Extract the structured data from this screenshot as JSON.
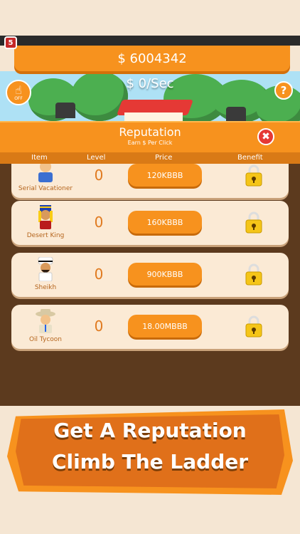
{
  "hud": {
    "level_badge": "5",
    "money": "$ 6004342",
    "per_sec": "$ 0/Sec",
    "auto_click_off": "OFF",
    "help": "?"
  },
  "reputation": {
    "title": "Reputation",
    "subtitle": "Earn $ Per Click",
    "close": "✖",
    "columns": {
      "item": "Item",
      "level": "Level",
      "price": "Price",
      "benefit": "Benefit"
    },
    "items": [
      {
        "name": "Serial Vacationer",
        "level": "0",
        "price": "120KBBB",
        "avatar_icon": "vacationer-icon",
        "benefit_icon": "lock-icon"
      },
      {
        "name": "Desert King",
        "level": "0",
        "price": "160KBBB",
        "avatar_icon": "pharaoh-icon",
        "benefit_icon": "lock-icon"
      },
      {
        "name": "Sheikh",
        "level": "0",
        "price": "900KBBB",
        "avatar_icon": "sheikh-icon",
        "benefit_icon": "lock-icon"
      },
      {
        "name": "Oil Tycoon",
        "level": "0",
        "price": "18.00MBBB",
        "avatar_icon": "tycoon-icon",
        "benefit_icon": "lock-icon"
      }
    ]
  },
  "banner": {
    "line1": "Get A Reputation",
    "line2": "Climb The Ladder"
  },
  "colors": {
    "accent": "#f7921e",
    "panel": "#5c3a1e",
    "card": "#fbead5"
  }
}
